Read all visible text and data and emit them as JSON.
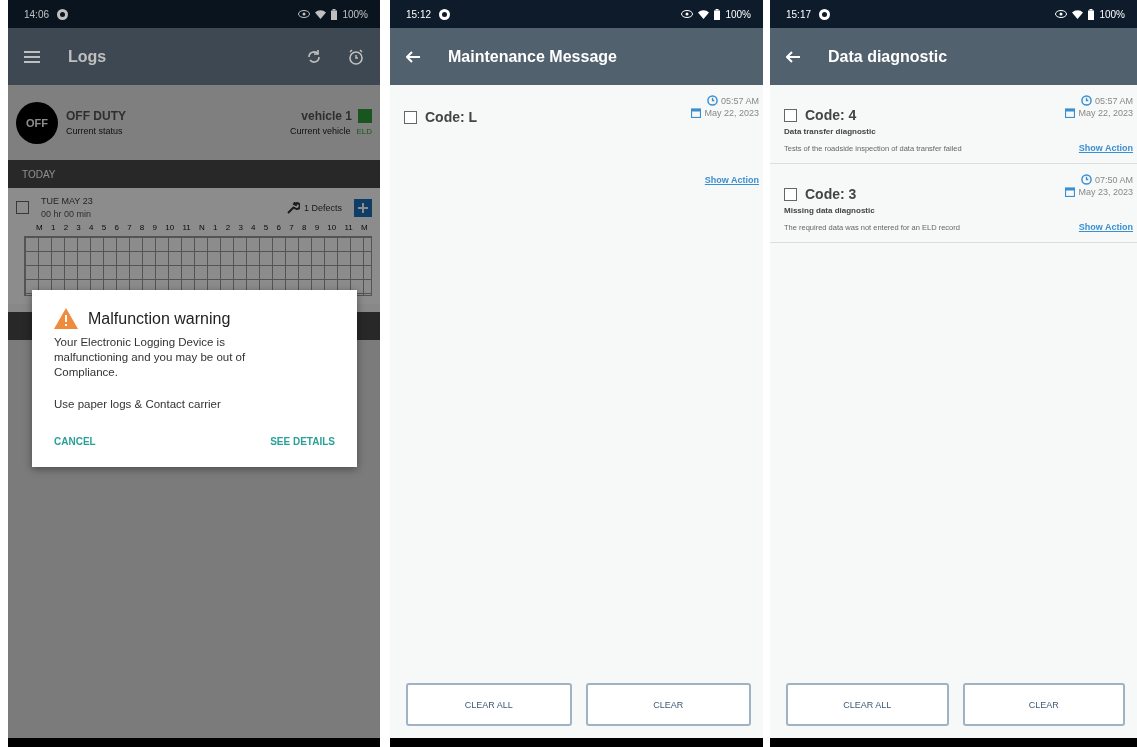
{
  "screens": [
    {
      "kind": "logs",
      "status_bar": {
        "time": "14:06",
        "battery": "100%"
      },
      "app_bar": {
        "title": "Logs"
      },
      "duty": {
        "badge": "OFF",
        "status": "OFF DUTY",
        "caption": "Current status"
      },
      "vehicle": {
        "name": "vehicle 1",
        "caption": "Current vehicle",
        "eld": "ELD"
      },
      "section": "TODAY",
      "log": {
        "date": "TUE MAY 23",
        "duration": "00 hr 00 min",
        "defects": "1 Defects",
        "checked": false,
        "hours": [
          "M",
          "1",
          "2",
          "3",
          "4",
          "5",
          "6",
          "7",
          "8",
          "9",
          "10",
          "11",
          "N",
          "1",
          "2",
          "3",
          "4",
          "5",
          "6",
          "7",
          "8",
          "9",
          "10",
          "11",
          "M"
        ]
      },
      "dialog": {
        "title": "Malfunction warning",
        "message": "Your Electronic Logging Device is malfunctioning and you may be out of Compliance.",
        "note": "Use paper logs & Contact carrier",
        "buttons": [
          "CANCEL",
          "SEE DETAILS"
        ]
      }
    },
    {
      "kind": "messages",
      "status_bar": {
        "time": "15:12",
        "battery": "100%"
      },
      "app_bar": {
        "title": "Maintenance Message"
      },
      "items": [
        {
          "code": "Code: L",
          "time": "05:57 AM",
          "date": "May 22, 2023",
          "action": "Show Action",
          "checked": false
        }
      ],
      "buttons": [
        "CLEAR ALL",
        "CLEAR"
      ]
    },
    {
      "kind": "messages",
      "status_bar": {
        "time": "15:17",
        "battery": "100%"
      },
      "app_bar": {
        "title": "Data diagnostic"
      },
      "items": [
        {
          "code": "Code: 4",
          "subtitle": "Data transfer diagnostic",
          "description": "Tests of the roadside inspection of data transfer failed",
          "time": "05:57 AM",
          "date": "May 22, 2023",
          "action": "Show Action",
          "checked": false
        },
        {
          "code": "Code: 3",
          "subtitle": "Missing data diagnostic",
          "description": "The required data was not entered for an ELD record",
          "time": "07:50 AM",
          "date": "May 23, 2023",
          "action": "Show Action",
          "checked": false
        }
      ],
      "buttons": [
        "CLEAR ALL",
        "CLEAR"
      ]
    }
  ]
}
